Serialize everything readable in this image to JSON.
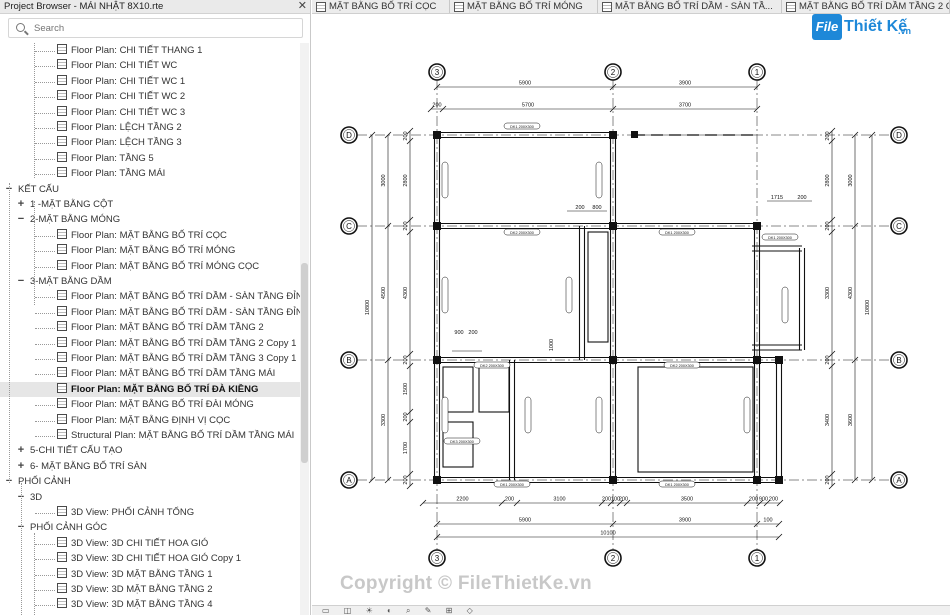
{
  "browser": {
    "title": "Project Browser - MÁI NHẬT 8X10.rte",
    "close": "✕",
    "search_placeholder": "Search",
    "rows": [
      {
        "label": "Floor Plan: CHI TIẾT THANG 1",
        "level": 3,
        "kind": "view"
      },
      {
        "label": "Floor Plan: CHI TIẾT WC",
        "level": 3,
        "kind": "view"
      },
      {
        "label": "Floor Plan: CHI TIẾT WC 1",
        "level": 3,
        "kind": "view"
      },
      {
        "label": "Floor Plan: CHI TIẾT WC 2",
        "level": 3,
        "kind": "view"
      },
      {
        "label": "Floor Plan: CHI TIẾT WC 3",
        "level": 3,
        "kind": "view"
      },
      {
        "label": "Floor Plan: LỆCH TẦNG 2",
        "level": 3,
        "kind": "view"
      },
      {
        "label": "Floor Plan: LỆCH TẦNG 3",
        "level": 3,
        "kind": "view"
      },
      {
        "label": "Floor Plan: TẦNG 5",
        "level": 3,
        "kind": "view"
      },
      {
        "label": "Floor Plan: TẦNG MÁI",
        "level": 3,
        "kind": "view"
      },
      {
        "label": "KẾT CẤU",
        "level": 1,
        "kind": "group",
        "exp": "−"
      },
      {
        "label": "1 -MẶT BẰNG CỘT",
        "level": 2,
        "kind": "group",
        "exp": "+"
      },
      {
        "label": "2-MẶT BẰNG MÓNG",
        "level": 2,
        "kind": "group",
        "exp": "−"
      },
      {
        "label": "Floor Plan: MẶT BẰNG BỐ TRÍ CỌC",
        "level": 3,
        "kind": "view"
      },
      {
        "label": "Floor Plan: MẶT BẰNG BỐ TRÍ MÓNG",
        "level": 3,
        "kind": "view"
      },
      {
        "label": "Floor Plan: MẶT BẰNG BỐ TRÍ MÓNG CỌC",
        "level": 3,
        "kind": "view"
      },
      {
        "label": "3-MẶT BẰNG DẦM",
        "level": 2,
        "kind": "group",
        "exp": "−"
      },
      {
        "label": "Floor Plan: MẶT BẰNG BỐ TRÍ DẦM - SÀN TẦNG ĐỈNH",
        "level": 3,
        "kind": "view"
      },
      {
        "label": "Floor Plan: MẶT BẰNG BỐ TRÍ DẦM - SÀN TẦNG ĐỈNH",
        "level": 3,
        "kind": "view"
      },
      {
        "label": "Floor Plan: MẶT BẰNG BỐ TRÍ DẦM TẦNG 2",
        "level": 3,
        "kind": "view"
      },
      {
        "label": "Floor Plan: MẶT BẰNG BỐ TRÍ DẦM TẦNG 2 Copy 1",
        "level": 3,
        "kind": "view"
      },
      {
        "label": "Floor Plan: MẶT BẰNG BỐ TRÍ DẦM TẦNG 3 Copy 1",
        "level": 3,
        "kind": "view"
      },
      {
        "label": "Floor Plan: MẶT BẰNG BỐ TRÍ DẦM TẦNG MÁI",
        "level": 3,
        "kind": "view"
      },
      {
        "label": "Floor Plan: MẶT BẰNG BỐ TRÍ ĐÀ KIỀNG",
        "level": 3,
        "kind": "view",
        "selected": true
      },
      {
        "label": "Floor Plan: MẶT BẰNG BỐ TRÍ ĐÀI MÓNG",
        "level": 3,
        "kind": "view"
      },
      {
        "label": "Floor Plan: MẶT BẰNG ĐỊNH VỊ CỌC",
        "level": 3,
        "kind": "view"
      },
      {
        "label": "Structural Plan: MẶT BẰNG BỐ TRÍ DẦM TẦNG MÁI",
        "level": 3,
        "kind": "view"
      },
      {
        "label": "5-CHI TIẾT CẤU TẠO",
        "level": 2,
        "kind": "group",
        "exp": "+"
      },
      {
        "label": "6- MẶT BẰNG BỐ TRÍ SÀN",
        "level": 2,
        "kind": "group",
        "exp": "+"
      },
      {
        "label": "PHỐI CẢNH",
        "level": 1,
        "kind": "group",
        "exp": "−"
      },
      {
        "label": "3D",
        "level": 2,
        "kind": "group",
        "exp": "−"
      },
      {
        "label": "3D View: PHỐI CẢNH TỔNG",
        "level": 3,
        "kind": "view"
      },
      {
        "label": "PHỐI CẢNH GÓC",
        "level": 2,
        "kind": "group",
        "exp": "−"
      },
      {
        "label": "3D View: 3D CHI TIẾT HOA GIÓ",
        "level": 3,
        "kind": "view"
      },
      {
        "label": "3D View: 3D CHI TIẾT HOA GIÓ Copy 1",
        "level": 3,
        "kind": "view"
      },
      {
        "label": "3D View: 3D MẶT BẰNG TẦNG 1",
        "level": 3,
        "kind": "view"
      },
      {
        "label": "3D View: 3D MẶT BẰNG TẦNG 2",
        "level": 3,
        "kind": "view"
      },
      {
        "label": "3D View: 3D MẶT BẰNG TẦNG 4",
        "level": 3,
        "kind": "view"
      }
    ]
  },
  "tabs": [
    {
      "label": "MẶT BẰNG BỐ TRÍ CỌC"
    },
    {
      "label": "MẶT BẰNG BỐ TRÍ MÓNG"
    },
    {
      "label": "MẶT BẰNG BỐ TRÍ DẦM - SÀN TẦ..."
    },
    {
      "label": "MẶT BẰNG BỐ TRÍ DẦM TẦNG 2 C..."
    }
  ],
  "logo": {
    "mark": "File",
    "name": "Thiết Kế",
    "domain": ".vn"
  },
  "watermark": "Copyright © FileThietKe.vn",
  "drawing": {
    "grid_top": [
      "3",
      "2",
      "1"
    ],
    "grid_bottom": [
      "3",
      "2",
      "1"
    ],
    "grid_left": [
      "D",
      "C",
      "B",
      "A"
    ],
    "grid_right": [
      "D",
      "C",
      "B",
      "A"
    ],
    "dims_top_1": [
      "5900",
      "3900"
    ],
    "dims_top_2": [
      "200",
      "5700",
      "3700"
    ],
    "dims_bottom_1": [
      "2200",
      "200",
      "3100",
      "200",
      "100",
      "200",
      "3500",
      "200",
      "900",
      "200"
    ],
    "dims_bottom_2": [
      "5900",
      "3900",
      "100"
    ],
    "dims_bottom_total": "10100",
    "dims_left_1": [
      "200",
      "2800",
      "200",
      "4300",
      "200",
      "1500",
      "200",
      "1700",
      "200"
    ],
    "dims_left_total": "10800",
    "dims_left_outer": [
      "3000",
      "4500",
      "3300"
    ],
    "dims_right": [
      "200",
      "2800",
      "200",
      "3300",
      "200",
      "3400",
      "200"
    ],
    "dims_right_outer": [
      "3000",
      "4300",
      "3600"
    ],
    "dims_right_total": "10800",
    "beam_labels": [
      "DK1 200X300",
      "DK2 200X300",
      "DK2 200X300",
      "DK1 200X300",
      "DK1 200X300",
      "DK2 200X300",
      "DK3 200X300",
      "DK1 200X300",
      "DK1 200X300"
    ],
    "local_dims": [
      "200",
      "800",
      "900",
      "200",
      "1000",
      "1715",
      "200"
    ]
  }
}
